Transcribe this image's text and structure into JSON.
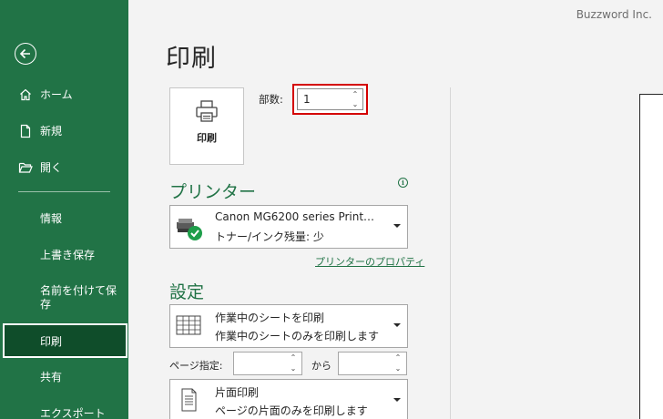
{
  "app": {
    "watermark": "Buzzword Inc."
  },
  "sidebar": {
    "back": "back-arrow-icon",
    "items": [
      {
        "label": "ホーム",
        "icon": "home-icon"
      },
      {
        "label": "新規",
        "icon": "new-document-icon"
      },
      {
        "label": "開く",
        "icon": "open-folder-icon"
      },
      {
        "label": "情報"
      },
      {
        "label": "上書き保存"
      },
      {
        "label": "名前を付けて保存"
      },
      {
        "label": "印刷",
        "selected": true
      },
      {
        "label": "共有"
      },
      {
        "label": "エクスポート"
      }
    ]
  },
  "main": {
    "title": "印刷",
    "print_button": {
      "label": "印刷",
      "icon": "printer-icon"
    },
    "copies": {
      "label": "部数:",
      "value": "1"
    },
    "printer": {
      "heading": "プリンター",
      "name": "Canon MG6200 series Print…",
      "status": "トナー/インク残量: 少",
      "properties_link": "プリンターのプロパティ",
      "icon": "printer-ready-icon"
    },
    "settings": {
      "heading": "設定",
      "scope": {
        "line1": "作業中のシートを印刷",
        "line2": "作業中のシートのみを印刷します",
        "icon": "sheet-grid-icon"
      },
      "pages": {
        "label": "ページ指定:",
        "to_label": "から",
        "from_value": "",
        "to_value": ""
      },
      "sides": {
        "line1": "片面印刷",
        "line2": "ページの片面のみを印刷します",
        "icon": "one-sided-icon"
      }
    }
  },
  "colors": {
    "accent": "#217346",
    "sidebar_selected": "#0f4d2a",
    "highlight_border": "#d40000",
    "status_ok": "#1e9e4a"
  }
}
